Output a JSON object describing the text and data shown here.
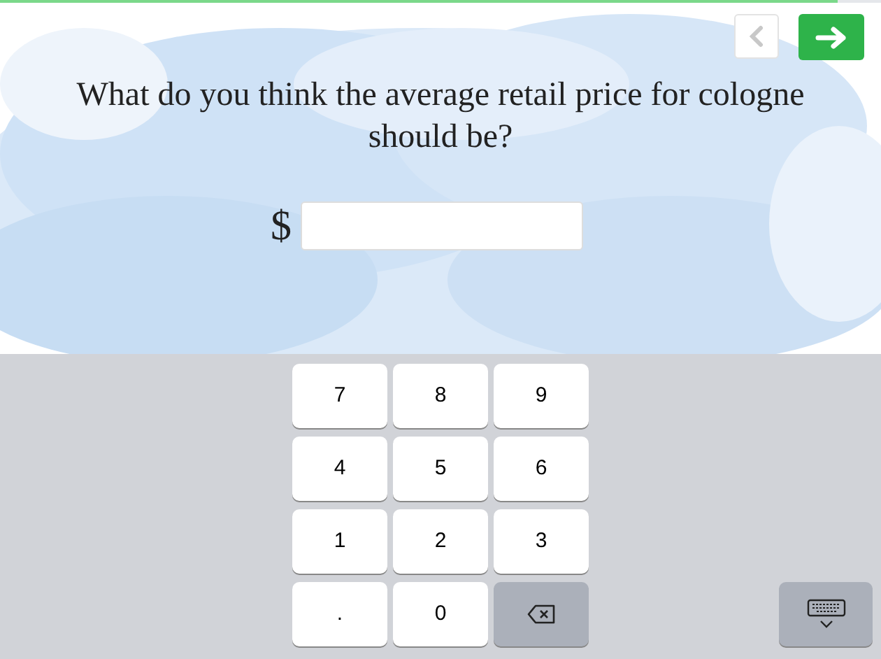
{
  "progress": {
    "level": 0.95
  },
  "nav": {
    "back_disabled": true
  },
  "question": "What do you think the average retail price for cologne should be?",
  "answer": {
    "prefix": "$"
  },
  "keypad": [
    {
      "kind": "key",
      "label": "7"
    },
    {
      "kind": "key",
      "label": "8"
    },
    {
      "kind": "key",
      "label": "9"
    },
    {
      "kind": "key",
      "label": "4"
    },
    {
      "kind": "key",
      "label": "5"
    },
    {
      "kind": "key",
      "label": "6"
    },
    {
      "kind": "key",
      "label": "1"
    },
    {
      "kind": "key",
      "label": "2"
    },
    {
      "kind": "key",
      "label": "3"
    },
    {
      "kind": "key",
      "label": "."
    },
    {
      "kind": "key",
      "label": "0"
    },
    {
      "kind": "backspace"
    }
  ]
}
